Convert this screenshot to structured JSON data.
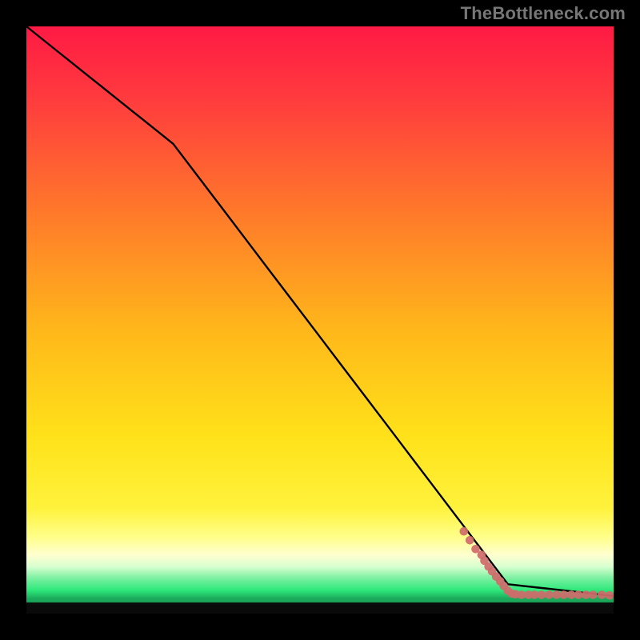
{
  "watermark": "TheBottleneck.com",
  "colors": {
    "frame": "#000000",
    "top_gradient": "#ff1a44",
    "mid_gradient": "#ffd400",
    "pale_band": "#ffffc0",
    "green_band": "#2ee87b",
    "curve": "#000000",
    "points": "#cf6b6b"
  },
  "chart_data": {
    "type": "line",
    "title": "",
    "xlabel": "",
    "ylabel": "",
    "xlim": [
      0,
      100
    ],
    "ylim": [
      0,
      100
    ],
    "curve": {
      "name": "bottleneck-curve",
      "points": [
        {
          "x": 0,
          "y": 100
        },
        {
          "x": 25,
          "y": 80
        },
        {
          "x": 82,
          "y": 5
        },
        {
          "x": 100,
          "y": 3
        }
      ]
    },
    "scatter": {
      "name": "sampled-points",
      "style": "dots",
      "points": [
        {
          "x": 74.5,
          "y": 14.0
        },
        {
          "x": 75.5,
          "y": 12.5
        },
        {
          "x": 76.5,
          "y": 11.0
        },
        {
          "x": 77.5,
          "y": 10.0
        },
        {
          "x": 78.0,
          "y": 9.0
        },
        {
          "x": 78.7,
          "y": 8.0
        },
        {
          "x": 79.3,
          "y": 7.2
        },
        {
          "x": 80.0,
          "y": 6.3
        },
        {
          "x": 80.7,
          "y": 5.5
        },
        {
          "x": 81.3,
          "y": 4.7
        },
        {
          "x": 82.0,
          "y": 3.9
        },
        {
          "x": 82.7,
          "y": 3.4
        },
        {
          "x": 83.3,
          "y": 3.3
        },
        {
          "x": 84.3,
          "y": 3.2
        },
        {
          "x": 85.5,
          "y": 3.2
        },
        {
          "x": 86.5,
          "y": 3.2
        },
        {
          "x": 87.7,
          "y": 3.2
        },
        {
          "x": 89.0,
          "y": 3.2
        },
        {
          "x": 90.3,
          "y": 3.2
        },
        {
          "x": 91.5,
          "y": 3.2
        },
        {
          "x": 92.8,
          "y": 3.2
        },
        {
          "x": 94.0,
          "y": 3.2
        },
        {
          "x": 95.3,
          "y": 3.2
        },
        {
          "x": 96.5,
          "y": 3.2
        },
        {
          "x": 98.0,
          "y": 3.2
        },
        {
          "x": 99.3,
          "y": 3.1
        }
      ]
    },
    "background_bands": [
      {
        "name": "red-yellow-gradient",
        "from_y": 100,
        "to_y": 13
      },
      {
        "name": "pale-band",
        "from_y": 13,
        "to_y": 6
      },
      {
        "name": "green-band",
        "from_y": 6,
        "to_y": 2.5
      },
      {
        "name": "baseline-dark",
        "from_y": 2.5,
        "to_y": 0
      }
    ]
  }
}
